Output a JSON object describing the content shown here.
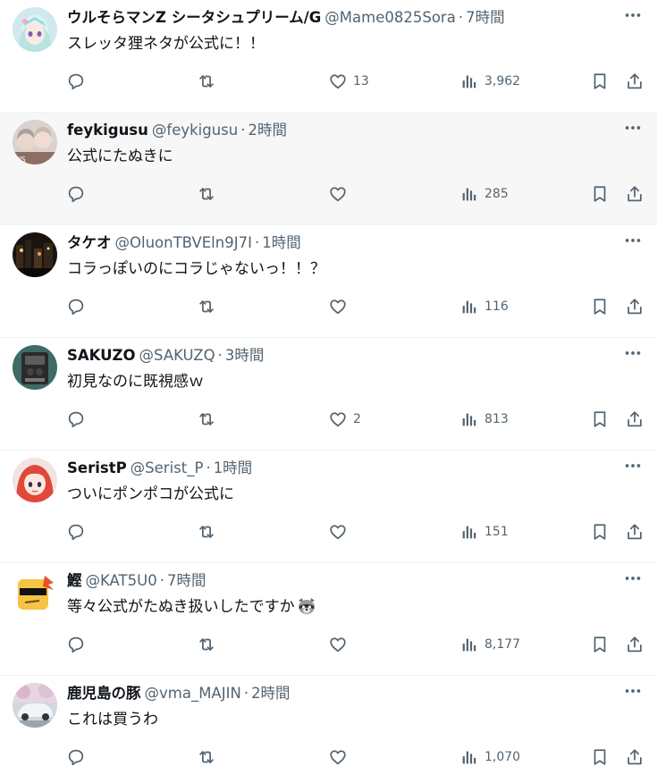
{
  "tweets": [
    {
      "display_name": "ウルそらマンZ シータシュプリーム/G",
      "handle": "@Mame0825Sora",
      "time": "7時間",
      "text": "スレッタ狸ネタが公式に！！",
      "likes": "13",
      "views": "3,962",
      "avatar_icon": "anime-girl-avatar"
    },
    {
      "display_name": "feykigusu",
      "handle": "@feykigusu",
      "time": "2時間",
      "text": "公式にたぬきに",
      "likes": "",
      "views": "285",
      "avatar_icon": "anime-group-avatar"
    },
    {
      "display_name": "タケオ",
      "handle": "@OluonTBVEln9J7I",
      "time": "1時間",
      "text": "コラっぽいのにコラじゃないっ！！？",
      "likes": "",
      "views": "116",
      "avatar_icon": "night-city-avatar"
    },
    {
      "display_name": "SAKUZO",
      "handle": "@SAKUZQ",
      "time": "3時間",
      "text": "初見なのに既視感ｗ",
      "likes": "2",
      "views": "813",
      "avatar_icon": "machine-avatar"
    },
    {
      "display_name": "SeristP",
      "handle": "@Serist_P",
      "time": "1時間",
      "text": "ついにポンポコが公式に",
      "likes": "",
      "views": "151",
      "avatar_icon": "red-hair-girl-avatar"
    },
    {
      "display_name": "鰹",
      "handle": "@KAT5U0",
      "time": "7時間",
      "text": "等々公式がたぬき扱いしたですか",
      "likes": "",
      "views": "8,177",
      "avatar_icon": "sunglasses-face-avatar",
      "emoji": "raccoon-emoji"
    },
    {
      "display_name": "鹿児島の豚",
      "handle": "@vma_MAJIN",
      "time": "2時間",
      "text": "これは買うわ",
      "likes": "",
      "views": "1,070",
      "avatar_icon": "car-avatar"
    }
  ],
  "colors": {
    "text_primary": "#0f1419",
    "text_secondary": "#536471",
    "hover_background": "#f7f7f7",
    "divider": "#eff3f4"
  },
  "hovered_index": 1
}
